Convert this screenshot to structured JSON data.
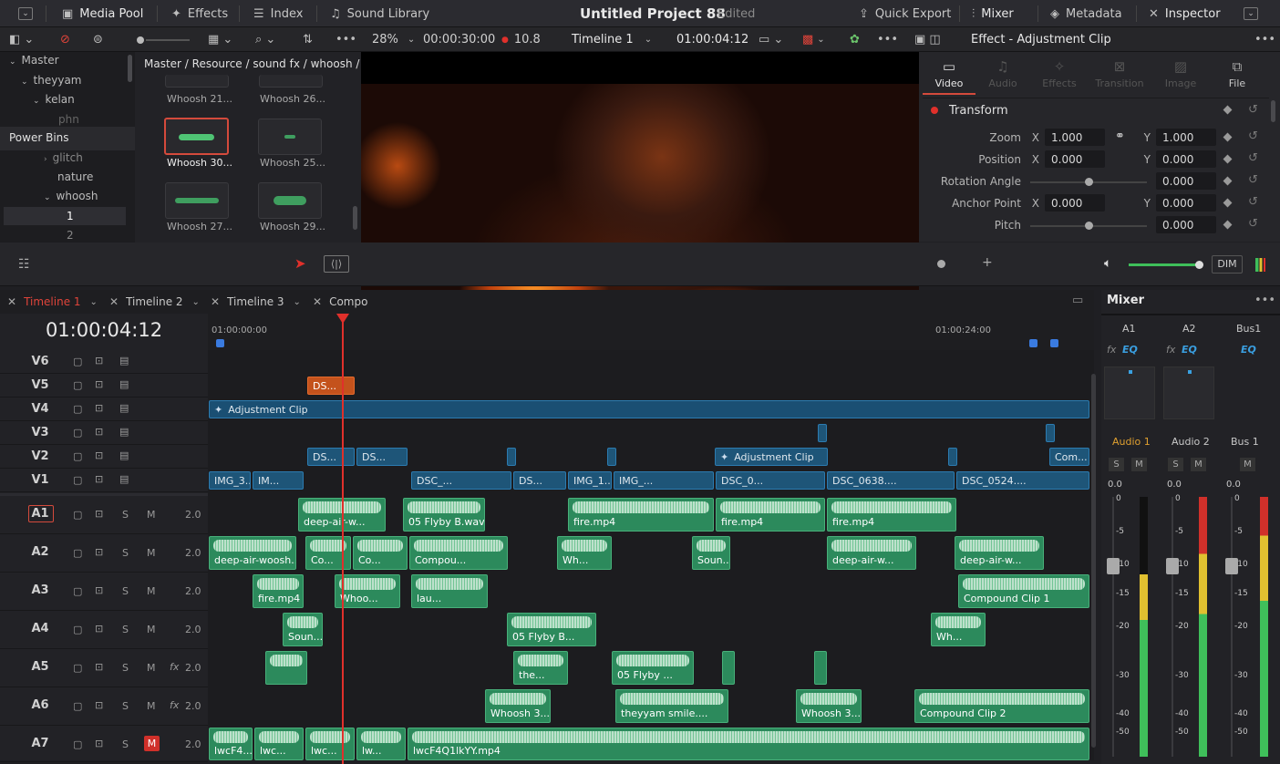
{
  "topbar": {
    "media_pool": "Media Pool",
    "effects": "Effects",
    "index": "Index",
    "sound_library": "Sound Library",
    "project_title": "Untitled Project 88",
    "edited": "Edited",
    "quick_export": "Quick Export",
    "mixer": "Mixer",
    "metadata": "Metadata",
    "inspector": "Inspector"
  },
  "viewer_bar": {
    "zoom": "28%",
    "duration": "00:00:30:00",
    "value": "10.8",
    "timeline_name": "Timeline 1",
    "timecode": "01:00:04:12"
  },
  "bins": {
    "master": "Master",
    "theyyam": "theyyam",
    "kelan": "kelan",
    "phn": "phn",
    "power_bins": "Power Bins",
    "glitch": "glitch",
    "nature": "nature",
    "whoosh": "whoosh",
    "one": "1",
    "two": "2"
  },
  "pool": {
    "breadcrumb": "Master / Resource / sound fx / whoosh / 1",
    "items": [
      "Whoosh 21...",
      "Whoosh 26...",
      "Whoosh 30...",
      "Whoosh 25...",
      "Whoosh 27...",
      "Whoosh 29..."
    ]
  },
  "inspector": {
    "title": "Effect - Adjustment Clip",
    "tabs": [
      "Video",
      "Audio",
      "Effects",
      "Transition",
      "Image",
      "File"
    ],
    "section": "Transform",
    "zoom_label": "Zoom",
    "zoom_x": "1.000",
    "zoom_y": "1.000",
    "position_label": "Position",
    "position_x": "0.000",
    "position_y": "0.000",
    "rotation_label": "Rotation Angle",
    "rotation": "0.000",
    "anchor_label": "Anchor Point",
    "anchor_x": "0.000",
    "anchor_y": "0.000",
    "pitch_label": "Pitch",
    "pitch": "0.000",
    "x": "X",
    "y": "Y"
  },
  "toolstrip": {
    "dim": "DIM"
  },
  "timeline_tabs": [
    "Timeline 1",
    "Timeline 2",
    "Timeline 3",
    "Compo"
  ],
  "timeline": {
    "timecode": "01:00:04:12",
    "ruler_start": "01:00:00:00",
    "ruler_end": "01:00:24:00",
    "video_tracks": [
      "V6",
      "V5",
      "V4",
      "V3",
      "V2",
      "V1"
    ],
    "audio_tracks": [
      "A1",
      "A2",
      "A3",
      "A4",
      "A5",
      "A6",
      "A7"
    ],
    "track_level": "2.0",
    "solo": "S",
    "mute": "M",
    "fx": "fx"
  },
  "clips": {
    "v5": [
      "DS..."
    ],
    "v4": [
      "Adjustment Clip"
    ],
    "v2": [
      "DS...",
      "DS...",
      "Adjustment Clip",
      "Com..."
    ],
    "v1": [
      "IMG_3...",
      "IM...",
      "DSC_...",
      "DS...",
      "IMG_1...",
      "IMG_...",
      "DSC_0...",
      "DSC_0638....",
      "DSC_0524...."
    ],
    "a1": [
      "deep-air-w...",
      "05 Flyby B.wav",
      "fire.mp4",
      "fire.mp4",
      "fire.mp4"
    ],
    "a2": [
      "deep-air-woosh...",
      "Co...",
      "Co...",
      "Compou...",
      "Wh...",
      "Soun...",
      "deep-air-w...",
      "deep-air-w..."
    ],
    "a3": [
      "fire.mp4",
      "Whoo...",
      "lau...",
      "Compound Clip 1"
    ],
    "a4": [
      "Soun...",
      "05 Flyby B...",
      "Wh..."
    ],
    "a5": [
      "the...",
      "05 Flyby ..."
    ],
    "a6": [
      "Whoosh 3...",
      "theyyam smile....",
      "Whoosh 3...",
      "Compound Clip 2"
    ],
    "a7": [
      "lwcF4...",
      "lwc...",
      "lwc...",
      "lw...",
      "lwcF4Q1lkYY.mp4"
    ]
  },
  "mixer": {
    "title": "Mixer",
    "channels": [
      "A1",
      "A2",
      "Bus1"
    ],
    "names": [
      "Audio 1",
      "Audio 2",
      "Bus 1"
    ],
    "levels": [
      "0.0",
      "0.0",
      "0.0"
    ],
    "scale": [
      "0",
      "-5",
      "-10",
      "-15",
      "-20",
      "-30",
      "-40",
      "-50"
    ]
  }
}
